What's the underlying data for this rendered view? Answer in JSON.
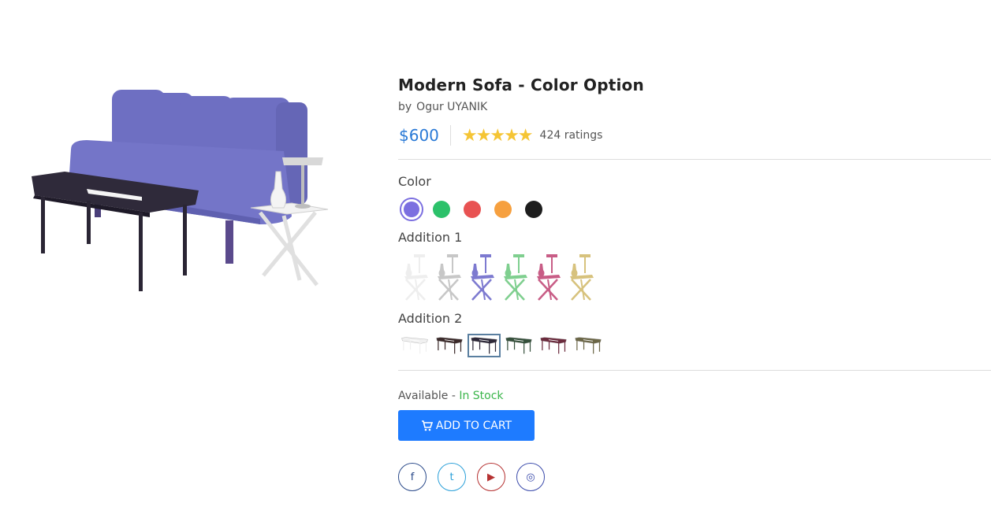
{
  "product": {
    "title": "Modern Sofa - Color Option",
    "by_label": "by",
    "author": "Ogur UYANIK",
    "price": "$600",
    "stars": "★★★★★",
    "ratings": "424 ratings"
  },
  "options": {
    "color_label": "Color",
    "colors": [
      "#7b6fe0",
      "#2cc16a",
      "#e85252",
      "#f6a03f",
      "#1d1d1d"
    ],
    "selected_color": "#7b6fe0",
    "addition1_label": "Addition 1",
    "addition1_colors": [
      "#eeeeee",
      "#c7c7c7",
      "#7d7ad0",
      "#7fcf8f",
      "#c85d86",
      "#d7c27d"
    ],
    "addition2_label": "Addition 2",
    "addition2_colors": [
      "#f0f0f0",
      "#3b2a2a",
      "#2d2838",
      "#35503b",
      "#6b2b3d",
      "#6b6646"
    ],
    "addition2_selected_index": 2
  },
  "availability": {
    "label": "Available",
    "sep": "-",
    "status": "In Stock"
  },
  "cart": {
    "label": "ADD TO CART"
  },
  "social": [
    {
      "name": "facebook",
      "glyph": "f",
      "color": "#2b4a8a"
    },
    {
      "name": "twitter",
      "glyph": "t",
      "color": "#2ba0d9"
    },
    {
      "name": "youtube",
      "glyph": "▶",
      "color": "#b53131"
    },
    {
      "name": "instagram",
      "glyph": "◎",
      "color": "#3b4bab"
    }
  ]
}
